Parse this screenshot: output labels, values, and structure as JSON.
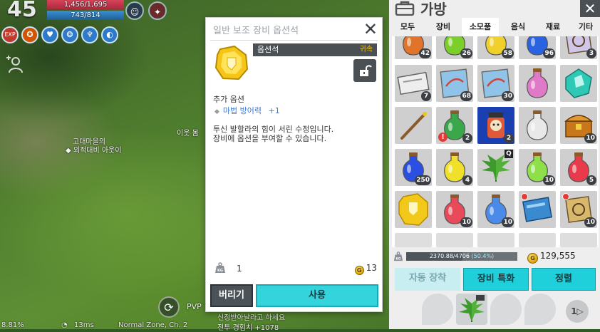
{
  "hud": {
    "level": "45",
    "hp": "1,456/1,695",
    "mp": "743/814",
    "buff_exp_label": "EXP",
    "npc_name_line1": "고대마을의",
    "npc_name_line2": "◆ 외적대비 아웃이",
    "npc_name_right": "이웃 몸",
    "pvp_label": "PVP",
    "status_left": "8.81%",
    "status_ping": "13ms",
    "status_zone": "Normal Zone, Ch. 2",
    "chat_line1": "신정받아날라고 하세요",
    "chat_line2": "전투 경험치 +1078"
  },
  "popup": {
    "title": "일반 보조 장비 옵션석",
    "close_label": "✕",
    "item_name": "옵션석",
    "bind_label": "귀속",
    "extra_title": "추가 옵션",
    "extra_option_name": "마법 방어력",
    "extra_option_value": "+1",
    "desc_line1": "투신 발할라의 힘이 서린 수정입니다.",
    "desc_line2": "장비에 옵션을 부여할 수 있습니다.",
    "kg_label": "KG",
    "quantity": "1",
    "price": "13",
    "gold_symbol": "G",
    "discard_label": "버리기",
    "use_label": "사용"
  },
  "inventory": {
    "title": "가방",
    "close_label": "✕",
    "tabs": [
      {
        "label": "모두"
      },
      {
        "label": "장비"
      },
      {
        "label": "소모품"
      },
      {
        "label": "음식"
      },
      {
        "label": "재료"
      },
      {
        "label": "기타"
      }
    ],
    "active_tab": "소모품",
    "slots_row1": [
      {
        "icon": "orange-potion-icon",
        "qty": "42",
        "color": "#e2742a"
      },
      {
        "icon": "green-potion-icon",
        "qty": "26",
        "color": "#7ccf2a"
      },
      {
        "icon": "yellow-potion-icon",
        "qty": "58",
        "color": "#f0d02a"
      },
      {
        "icon": "blue-potion-icon",
        "qty": "96",
        "color": "#2a63e2"
      },
      {
        "icon": "scroll-icon",
        "qty": "3",
        "color": "#cfc6e8"
      }
    ],
    "slots_row2": [
      {
        "icon": "ticket-icon",
        "qty": "7",
        "color": "#d8d8d8"
      },
      {
        "icon": "map-icon",
        "qty": "68",
        "color": "#8fc4e8"
      },
      {
        "icon": "map-icon",
        "qty": "30",
        "color": "#8fc4e8"
      },
      {
        "icon": "pink-potion-icon",
        "qty": "",
        "color": "#e07ac8"
      },
      {
        "icon": "teal-crystal-icon",
        "qty": "",
        "color": "#2ec9b5"
      }
    ],
    "slots_row3": [
      {
        "icon": "wand-icon",
        "qty": "",
        "color": "#8a5a2a"
      },
      {
        "icon": "green-potion-icon",
        "qty": "2",
        "color": "#3aa84a",
        "warn": true
      },
      {
        "icon": "bear-jar-icon",
        "qty": "2",
        "color": "#e05a3a",
        "selected": true
      },
      {
        "icon": "empty-potion-icon",
        "qty": "",
        "color": "#e8e8e8"
      },
      {
        "icon": "treasure-chest-icon",
        "qty": "10",
        "color": "#c8781a"
      }
    ],
    "slots_row4": [
      {
        "icon": "blue-potion-icon",
        "qty": "250",
        "color": "#2a4fe2"
      },
      {
        "icon": "yellow-potion-icon",
        "qty": "4",
        "color": "#f0e02a"
      },
      {
        "icon": "herb-icon",
        "qty": "",
        "color": "#3a8a2a",
        "qbadge": "Q"
      },
      {
        "icon": "green-potion-icon",
        "qty": "10",
        "color": "#8ee04a"
      },
      {
        "icon": "red-potion-icon",
        "qty": "5",
        "color": "#e83a4a"
      }
    ],
    "slots_row5": [
      {
        "icon": "option-stone-icon",
        "qty": "",
        "color": "#f2c81a"
      },
      {
        "icon": "red-potion-icon",
        "qty": "10",
        "color": "#e84a5a"
      },
      {
        "icon": "blue-potion-icon",
        "qty": "10",
        "color": "#4a8ae8"
      },
      {
        "icon": "blue-book-icon",
        "qty": "",
        "color": "#3a8ad0",
        "newdot": true
      },
      {
        "icon": "star-scroll-icon",
        "qty": "10",
        "color": "#d8b86a",
        "newdot": true
      }
    ],
    "kg_label": "KG",
    "weight_text": "2370.88/4706",
    "weight_pct": "(50.4%)",
    "weight_fraction": 0.504,
    "gold_symbol": "G",
    "gold_amount": "129,555",
    "auto_equip_label": "자동 장착",
    "equip_spec_label": "장비 특화",
    "sort_label": "정렬",
    "next_label": "1▷"
  },
  "colors": {
    "accent": "#1fd0da",
    "selected_slot": "#1a3fb0",
    "option_text": "#3d7bd8",
    "bind_text": "#f0c419"
  }
}
